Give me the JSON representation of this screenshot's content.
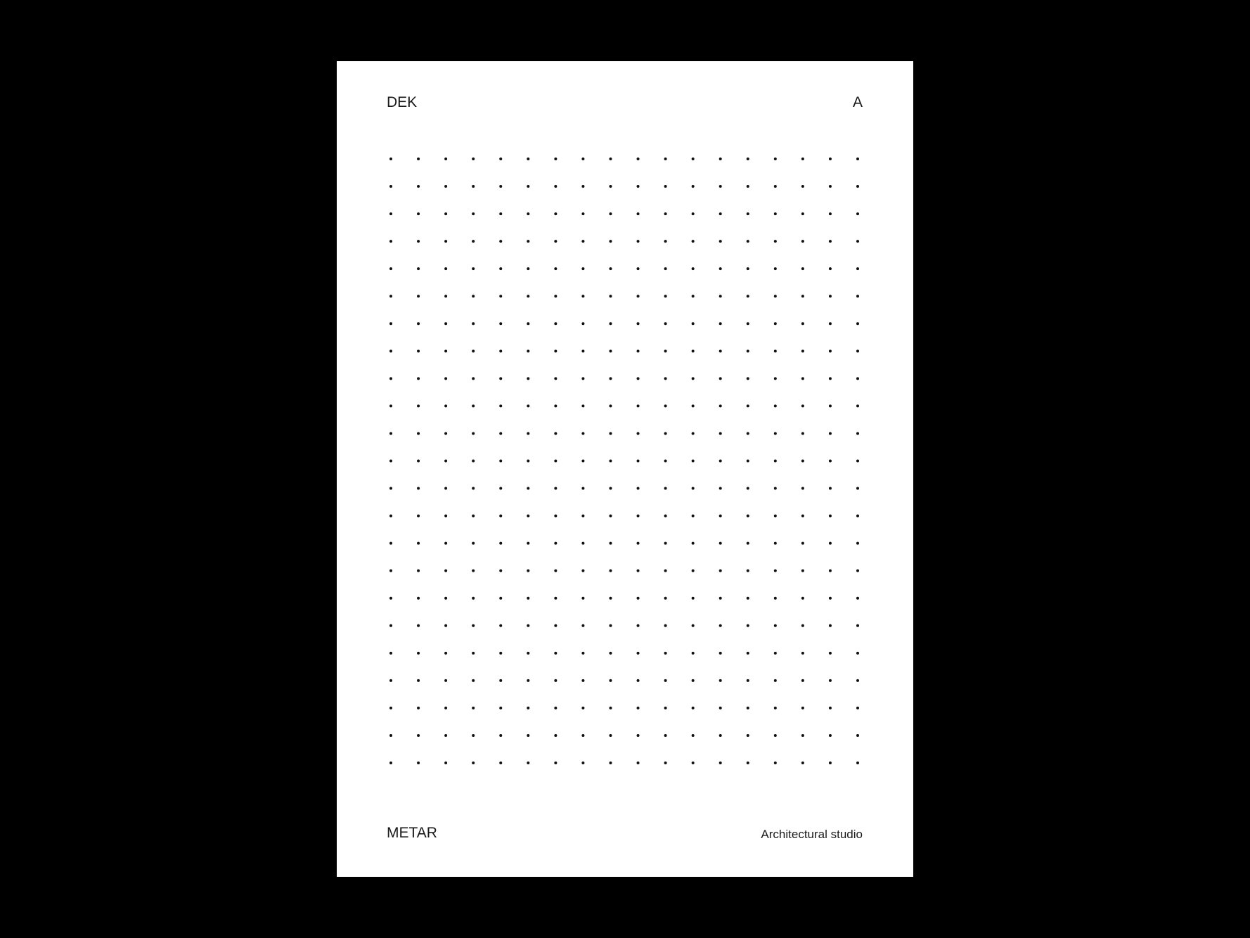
{
  "poster": {
    "top_left_text": "DEK",
    "top_right_text": "A",
    "bottom_left_text": "METAR",
    "bottom_right_text": "Architectural studio"
  },
  "dot_grid": {
    "columns": 18,
    "rows": 23,
    "dot_color": "#111111"
  },
  "colors": {
    "background": "#000000",
    "sheet": "#ffffff",
    "text": "#1a1a1a"
  }
}
